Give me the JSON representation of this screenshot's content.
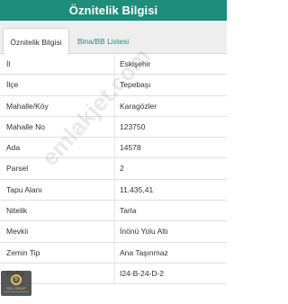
{
  "header": {
    "title": "Öznitelik Bilgisi"
  },
  "tabs": [
    {
      "label": "Öznitelik Bilgisi",
      "active": true
    },
    {
      "label": "Bina/BB Listesi",
      "active": false
    }
  ],
  "rows": [
    {
      "label": "İl",
      "value": "Eskişehir"
    },
    {
      "label": "İlçe",
      "value": "Tepebaşı"
    },
    {
      "label": "Mahalle/Köy",
      "value": "Karagözler"
    },
    {
      "label": "Mahalle No",
      "value": "123750"
    },
    {
      "label": "Ada",
      "value": "14578"
    },
    {
      "label": "Parsel",
      "value": "2"
    },
    {
      "label": "Tapu Alanı",
      "value": "11.435,41"
    },
    {
      "label": "Nitelik",
      "value": "Tarla"
    },
    {
      "label": "Mevkii",
      "value": "İnönü Yolu Altı"
    },
    {
      "label": "Zemin Tip",
      "value": "Ana Taşınmaz"
    },
    {
      "label": "Pafta",
      "value": "I24-B-24-D-2"
    }
  ],
  "watermark": {
    "text": "emlakjet.com"
  },
  "logo": {
    "mark": "S",
    "text": "SEL GRUP"
  },
  "colors": {
    "accent": "#1e8d7a",
    "tabbar_bg": "#eeeeee",
    "logo_gold": "#e0b84a"
  }
}
